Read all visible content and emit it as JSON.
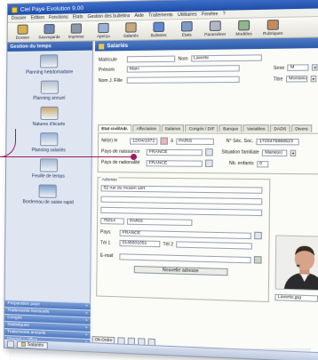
{
  "window": {
    "title": "Ciel Paye Evolution 9.00",
    "accent": "#2c5aa8"
  },
  "menubar": [
    "Dossier",
    "Edition",
    "Fonctions",
    "Etats",
    "Gestion des bulletins",
    "Aide",
    "Traitements",
    "Utilitaires",
    "Fenêtre",
    "?"
  ],
  "toolbar": [
    {
      "label": "Dossier",
      "icon": "folder-icon",
      "color": "#d7b24a"
    },
    {
      "label": "Sauvegarde",
      "icon": "save-icon",
      "color": "#6d88b8"
    },
    {
      "label": "Imprimer",
      "icon": "printer-icon",
      "color": "#8c9aa8"
    },
    {
      "label": "Aperçu",
      "icon": "preview-icon",
      "color": "#9cb2d4"
    },
    {
      "label": "Salariés",
      "icon": "employees-icon",
      "color": "#c7a97a"
    },
    {
      "label": "Bulletins",
      "icon": "payslips-icon",
      "color": "#5d8ad0"
    },
    {
      "label": "Etats",
      "icon": "reports-icon",
      "color": "#7e9cc6"
    },
    {
      "label": "Paramétrer",
      "icon": "settings-icon",
      "color": "#b0b8c8"
    },
    {
      "label": "Modèles",
      "icon": "templates-icon",
      "color": "#8fb58a"
    },
    {
      "label": "Rubriques",
      "icon": "items-icon",
      "color": "#c58c5a"
    }
  ],
  "leftnav": {
    "header": "Gestion du temps",
    "items": [
      {
        "label": "Planning hebdomadaire",
        "icon": "weekly-planning-icon",
        "color": "#9ab0c8"
      },
      {
        "label": "Planning annuel",
        "icon": "annual-planning-icon",
        "color": "#b6c2d2"
      },
      {
        "label": "Natures d'écarts",
        "icon": "variance-types-icon",
        "color": "#c9a870"
      },
      {
        "label": "Planning salariés",
        "icon": "staff-planning-icon",
        "color": "#9bb4d6"
      },
      {
        "label": "Feuille de temps",
        "icon": "timesheet-icon",
        "color": "#a7b8cf"
      },
      {
        "label": "Bordereau de saisie rapid",
        "icon": "quick-entry-icon",
        "color": "#7ea0cc"
      }
    ],
    "sections": [
      "Préparation paye",
      "Traitements mensuels",
      "Congés",
      "Statistiques",
      "Traitements annuels",
      "Internet + Office",
      "Mes préférés"
    ]
  },
  "document": {
    "title": "Salariés",
    "matricule_label": "Matricule",
    "nom_label": "Nom",
    "nom_value": "Laverte",
    "prenom_label": "Prénom",
    "prenom_value": "Marc",
    "nomjf_label": "Nom J. Fille",
    "sexe_label": "Sexe",
    "sexe_value": "M",
    "titre_label": "Titre",
    "titre_value": "Monsieur"
  },
  "tabs": [
    "Etat civil/Adr.",
    "Affectation",
    "Salaires",
    "Congés / DIF",
    "Banque",
    "Variables",
    "DADS",
    "Divers"
  ],
  "etat_civil": {
    "naissance_label": "Né(e) le",
    "naissance_value": "12/04/1972",
    "a_label": "à",
    "a_value": "PARIS",
    "secu_label": "N° Séc. Soc.",
    "secu_value": "1720475888523",
    "pays_naissance_label": "Pays de naissance",
    "pays_naissance_value": "FRANCE",
    "situation_label": "Situation familiale",
    "situation_value": "Marié(e)",
    "nationalite_label": "Pays de nationalité",
    "nationalite_value": "FRANCE",
    "enfants_label": "Nb. enfants",
    "enfants_value": "0"
  },
  "adresse": {
    "legend": "Adresse",
    "line1": "52 rue du moulin vert",
    "cp": "75014",
    "ville": "PARIS",
    "pays_label": "Pays",
    "pays": "FRANCE",
    "tel1_label": "Tél 1",
    "tel1": "0145001051",
    "tel2_label": "Tél 2",
    "email_label": "E-mail",
    "button": "Nouvelle adresse"
  },
  "photo": {
    "caption": "Laverte.jpg"
  },
  "statusbar": {
    "button": "Ok-Ordre"
  },
  "taskbar": {
    "item": "Salariés"
  }
}
